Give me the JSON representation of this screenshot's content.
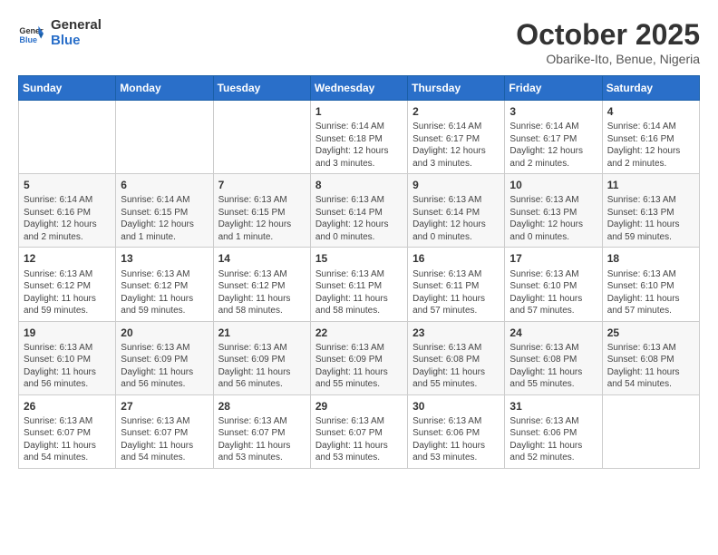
{
  "header": {
    "logo_general": "General",
    "logo_blue": "Blue",
    "month": "October 2025",
    "location": "Obarike-Ito, Benue, Nigeria"
  },
  "weekdays": [
    "Sunday",
    "Monday",
    "Tuesday",
    "Wednesday",
    "Thursday",
    "Friday",
    "Saturday"
  ],
  "weeks": [
    [
      {
        "day": "",
        "info": ""
      },
      {
        "day": "",
        "info": ""
      },
      {
        "day": "",
        "info": ""
      },
      {
        "day": "1",
        "info": "Sunrise: 6:14 AM\nSunset: 6:18 PM\nDaylight: 12 hours\nand 3 minutes."
      },
      {
        "day": "2",
        "info": "Sunrise: 6:14 AM\nSunset: 6:17 PM\nDaylight: 12 hours\nand 3 minutes."
      },
      {
        "day": "3",
        "info": "Sunrise: 6:14 AM\nSunset: 6:17 PM\nDaylight: 12 hours\nand 2 minutes."
      },
      {
        "day": "4",
        "info": "Sunrise: 6:14 AM\nSunset: 6:16 PM\nDaylight: 12 hours\nand 2 minutes."
      }
    ],
    [
      {
        "day": "5",
        "info": "Sunrise: 6:14 AM\nSunset: 6:16 PM\nDaylight: 12 hours\nand 2 minutes."
      },
      {
        "day": "6",
        "info": "Sunrise: 6:14 AM\nSunset: 6:15 PM\nDaylight: 12 hours\nand 1 minute."
      },
      {
        "day": "7",
        "info": "Sunrise: 6:13 AM\nSunset: 6:15 PM\nDaylight: 12 hours\nand 1 minute."
      },
      {
        "day": "8",
        "info": "Sunrise: 6:13 AM\nSunset: 6:14 PM\nDaylight: 12 hours\nand 0 minutes."
      },
      {
        "day": "9",
        "info": "Sunrise: 6:13 AM\nSunset: 6:14 PM\nDaylight: 12 hours\nand 0 minutes."
      },
      {
        "day": "10",
        "info": "Sunrise: 6:13 AM\nSunset: 6:13 PM\nDaylight: 12 hours\nand 0 minutes."
      },
      {
        "day": "11",
        "info": "Sunrise: 6:13 AM\nSunset: 6:13 PM\nDaylight: 11 hours\nand 59 minutes."
      }
    ],
    [
      {
        "day": "12",
        "info": "Sunrise: 6:13 AM\nSunset: 6:12 PM\nDaylight: 11 hours\nand 59 minutes."
      },
      {
        "day": "13",
        "info": "Sunrise: 6:13 AM\nSunset: 6:12 PM\nDaylight: 11 hours\nand 59 minutes."
      },
      {
        "day": "14",
        "info": "Sunrise: 6:13 AM\nSunset: 6:12 PM\nDaylight: 11 hours\nand 58 minutes."
      },
      {
        "day": "15",
        "info": "Sunrise: 6:13 AM\nSunset: 6:11 PM\nDaylight: 11 hours\nand 58 minutes."
      },
      {
        "day": "16",
        "info": "Sunrise: 6:13 AM\nSunset: 6:11 PM\nDaylight: 11 hours\nand 57 minutes."
      },
      {
        "day": "17",
        "info": "Sunrise: 6:13 AM\nSunset: 6:10 PM\nDaylight: 11 hours\nand 57 minutes."
      },
      {
        "day": "18",
        "info": "Sunrise: 6:13 AM\nSunset: 6:10 PM\nDaylight: 11 hours\nand 57 minutes."
      }
    ],
    [
      {
        "day": "19",
        "info": "Sunrise: 6:13 AM\nSunset: 6:10 PM\nDaylight: 11 hours\nand 56 minutes."
      },
      {
        "day": "20",
        "info": "Sunrise: 6:13 AM\nSunset: 6:09 PM\nDaylight: 11 hours\nand 56 minutes."
      },
      {
        "day": "21",
        "info": "Sunrise: 6:13 AM\nSunset: 6:09 PM\nDaylight: 11 hours\nand 56 minutes."
      },
      {
        "day": "22",
        "info": "Sunrise: 6:13 AM\nSunset: 6:09 PM\nDaylight: 11 hours\nand 55 minutes."
      },
      {
        "day": "23",
        "info": "Sunrise: 6:13 AM\nSunset: 6:08 PM\nDaylight: 11 hours\nand 55 minutes."
      },
      {
        "day": "24",
        "info": "Sunrise: 6:13 AM\nSunset: 6:08 PM\nDaylight: 11 hours\nand 55 minutes."
      },
      {
        "day": "25",
        "info": "Sunrise: 6:13 AM\nSunset: 6:08 PM\nDaylight: 11 hours\nand 54 minutes."
      }
    ],
    [
      {
        "day": "26",
        "info": "Sunrise: 6:13 AM\nSunset: 6:07 PM\nDaylight: 11 hours\nand 54 minutes."
      },
      {
        "day": "27",
        "info": "Sunrise: 6:13 AM\nSunset: 6:07 PM\nDaylight: 11 hours\nand 54 minutes."
      },
      {
        "day": "28",
        "info": "Sunrise: 6:13 AM\nSunset: 6:07 PM\nDaylight: 11 hours\nand 53 minutes."
      },
      {
        "day": "29",
        "info": "Sunrise: 6:13 AM\nSunset: 6:07 PM\nDaylight: 11 hours\nand 53 minutes."
      },
      {
        "day": "30",
        "info": "Sunrise: 6:13 AM\nSunset: 6:06 PM\nDaylight: 11 hours\nand 53 minutes."
      },
      {
        "day": "31",
        "info": "Sunrise: 6:13 AM\nSunset: 6:06 PM\nDaylight: 11 hours\nand 52 minutes."
      },
      {
        "day": "",
        "info": ""
      }
    ]
  ]
}
